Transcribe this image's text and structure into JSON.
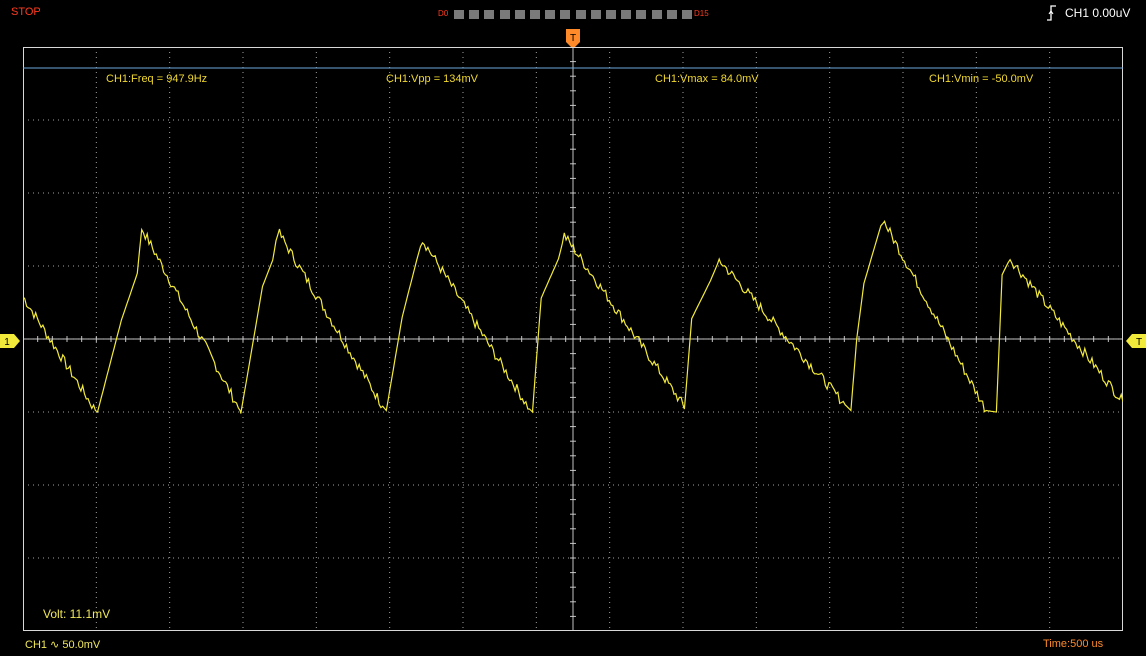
{
  "status": "STOP",
  "digital_channels": {
    "first_label": "D0",
    "last_label": "D15",
    "count": 16
  },
  "trigger": {
    "icon": "rising-edge-icon",
    "readout": "CH1 0.00uV",
    "marker": "T"
  },
  "channel_marker": "1",
  "measurements": {
    "freq": "CH1:Freq = 947.9Hz",
    "vpp": "CH1:Vpp = 134mV",
    "vmax": "CH1:Vmax = 84.0mV",
    "vmin": "CH1:Vmin = -50.0mV"
  },
  "cursor_readout": "Volt: 11.1mV",
  "channel_scale": "CH1 ∿ 50.0mV",
  "timebase": "Time:500 us",
  "colors": {
    "trace": "#f2ea3a",
    "status": "#ff3b1f",
    "trigger": "#ff8a2a",
    "grid": "#d8d8d8",
    "cursor": "#6ea8dc"
  },
  "chart_data": {
    "type": "line",
    "x_unit": "divisions",
    "y_unit": "mV",
    "xlim": [
      -7.6,
      7.6
    ],
    "ylim": [
      -200,
      200
    ],
    "series": [
      {
        "x": [
          -7.6,
          -6.6,
          -6.57,
          -6.24,
          -6.02,
          -5.96,
          -4.6,
          -4.59,
          -4.29,
          -4.15,
          -4.08,
          -2.63,
          -2.58,
          -2.36,
          -2.16,
          -2.08,
          -0.6,
          -0.56,
          -0.44,
          -0.2,
          -0.12,
          1.52,
          1.54,
          1.64,
          1.9,
          2.02,
          3.76,
          3.84,
          3.92,
          4.02,
          4.28,
          5.71,
          5.85,
          5.93,
          6.04,
          7.6
        ],
        "y": [
          29,
          -49,
          -50,
          13,
          45,
          76,
          -49,
          -51,
          36,
          54,
          74,
          -46,
          -49,
          15,
          54,
          68,
          -48,
          -50,
          28,
          55,
          71,
          -45,
          -48,
          14,
          40,
          54,
          -45,
          -49,
          0,
          38,
          82,
          -49,
          -50,
          44,
          55,
          -43
        ]
      }
    ],
    "trigger_level_mV": 0,
    "cursor_level_mV": 165,
    "grid": true,
    "grid_divisions": {
      "x": 15,
      "y": 8
    }
  }
}
